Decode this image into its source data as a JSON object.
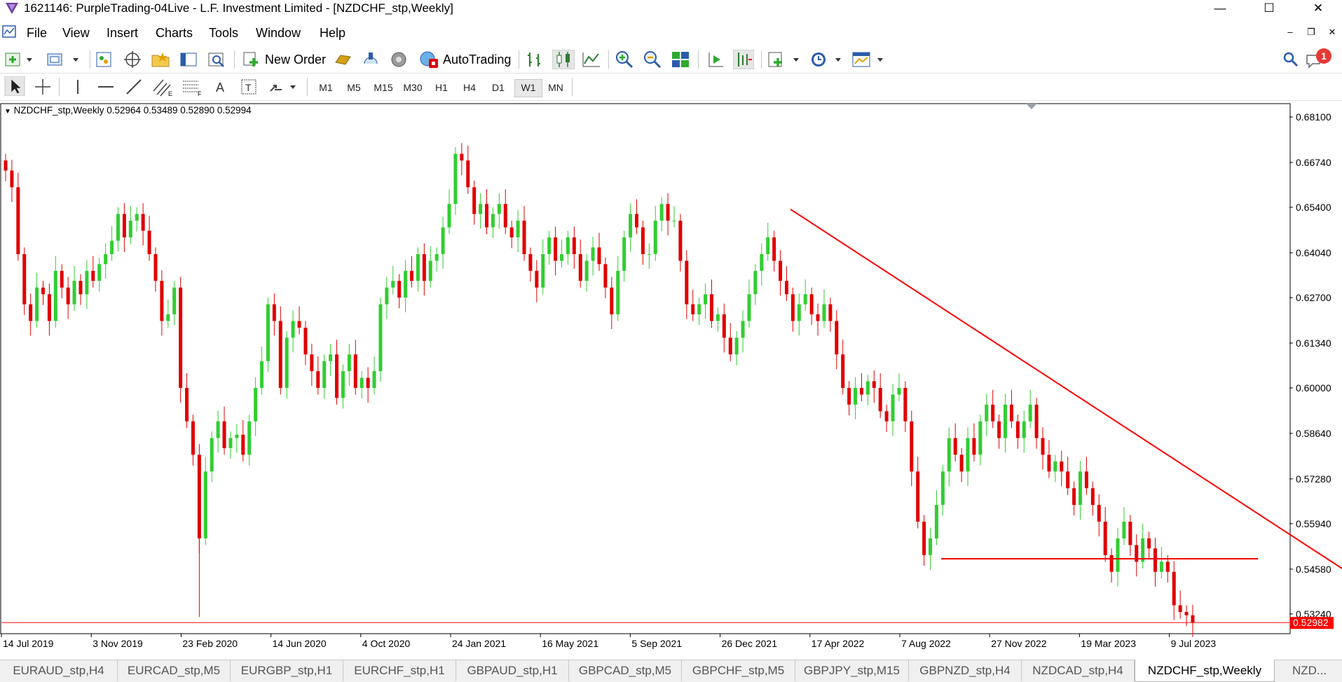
{
  "window": {
    "title": "1621146: PurpleTrading-04Live - L.F. Investment Limited - [NZDCHF_stp,Weekly]",
    "minimize_glyph": "—",
    "maximize_glyph": "☐",
    "close_glyph": "✕"
  },
  "menu": {
    "items": [
      "File",
      "View",
      "Insert",
      "Charts",
      "Tools",
      "Window",
      "Help"
    ],
    "mdi": [
      "–",
      "❐",
      "✕"
    ]
  },
  "toolbar": {
    "new_order": "New Order",
    "autotrading": "AutoTrading",
    "notification_count": "1"
  },
  "timeframes": {
    "items": [
      "M1",
      "M5",
      "M15",
      "M30",
      "H1",
      "H4",
      "D1",
      "W1",
      "MN"
    ],
    "active": "W1"
  },
  "chart": {
    "info": "NZDCHF_stp,Weekly  0.52964 0.53489 0.52890 0.52994",
    "current_price_label": "0.52982",
    "colors": {
      "bull": "#32cd32",
      "bear": "#e00000",
      "trendline": "#ff0000",
      "price_line": "#ff0000",
      "price_label_bg": "#ff0000"
    }
  },
  "chart_data": {
    "type": "candlestick",
    "symbol": "NZDCHF_stp",
    "timeframe": "Weekly",
    "ohlc_last": {
      "open": 0.52964,
      "high": 0.53489,
      "low": 0.5289,
      "close": 0.52994
    },
    "y_ticks": [
      0.681,
      0.6674,
      0.654,
      0.6404,
      0.627,
      0.6134,
      0.6,
      0.5864,
      0.5728,
      0.5594,
      0.5458,
      0.5324
    ],
    "y_tick_labels": [
      "0.68100",
      "0.66740",
      "0.65400",
      "0.64040",
      "0.62700",
      "0.61340",
      "0.60000",
      "0.58640",
      "0.57280",
      "0.55940",
      "0.54580",
      "0.53240"
    ],
    "x_tick_labels": [
      "14 Jul 2019",
      "3 Nov 2019",
      "23 Feb 2020",
      "14 Jun 2020",
      "4 Oct 2020",
      "24 Jan 2021",
      "16 May 2021",
      "5 Sep 2021",
      "26 Dec 2021",
      "17 Apr 2022",
      "7 Aug 2022",
      "27 Nov 2022",
      "19 Mar 2023",
      "9 Jul 2023"
    ],
    "approx_closes": [
      0.665,
      0.66,
      0.64,
      0.625,
      0.62,
      0.63,
      0.628,
      0.62,
      0.635,
      0.63,
      0.625,
      0.632,
      0.628,
      0.635,
      0.632,
      0.637,
      0.64,
      0.644,
      0.652,
      0.645,
      0.65,
      0.652,
      0.647,
      0.64,
      0.632,
      0.62,
      0.622,
      0.63,
      0.6,
      0.59,
      0.58,
      0.555,
      0.575,
      0.585,
      0.59,
      0.582,
      0.585,
      0.586,
      0.58,
      0.59,
      0.6,
      0.608,
      0.625,
      0.62,
      0.6,
      0.615,
      0.62,
      0.618,
      0.61,
      0.605,
      0.6,
      0.608,
      0.61,
      0.597,
      0.605,
      0.61,
      0.6,
      0.603,
      0.6,
      0.605,
      0.625,
      0.63,
      0.632,
      0.627,
      0.635,
      0.632,
      0.64,
      0.632,
      0.638,
      0.64,
      0.648,
      0.655,
      0.67,
      0.668,
      0.66,
      0.652,
      0.655,
      0.648,
      0.652,
      0.655,
      0.648,
      0.645,
      0.65,
      0.64,
      0.635,
      0.63,
      0.64,
      0.645,
      0.638,
      0.64,
      0.645,
      0.64,
      0.632,
      0.638,
      0.642,
      0.637,
      0.63,
      0.622,
      0.635,
      0.645,
      0.652,
      0.648,
      0.64,
      0.64,
      0.65,
      0.655,
      0.65,
      0.65,
      0.638,
      0.625,
      0.622,
      0.625,
      0.628,
      0.62,
      0.622,
      0.615,
      0.61,
      0.615,
      0.62,
      0.628,
      0.635,
      0.64,
      0.645,
      0.638,
      0.632,
      0.628,
      0.62,
      0.625,
      0.628,
      0.622,
      0.62,
      0.625,
      0.62,
      0.61,
      0.6,
      0.595,
      0.6,
      0.598,
      0.602,
      0.6,
      0.593,
      0.59,
      0.598,
      0.6,
      0.59,
      0.575,
      0.56,
      0.55,
      0.555,
      0.565,
      0.575,
      0.585,
      0.58,
      0.575,
      0.585,
      0.58,
      0.59,
      0.595,
      0.59,
      0.585,
      0.595,
      0.59,
      0.585,
      0.59,
      0.595,
      0.585,
      0.58,
      0.575,
      0.578,
      0.575,
      0.57,
      0.565,
      0.575,
      0.57,
      0.565,
      0.56,
      0.55,
      0.545,
      0.555,
      0.56,
      0.553,
      0.548,
      0.555,
      0.552,
      0.545,
      0.548,
      0.545,
      0.535,
      0.533,
      0.532,
      0.5299
    ],
    "trendlines": [
      {
        "kind": "descending-resistance",
        "from": {
          "date": "2022-02-20",
          "price": 0.6534
        },
        "to": {
          "date": "2023-11-05",
          "price": 0.546
        }
      },
      {
        "kind": "horizontal-support",
        "price": 0.5489,
        "from_date": "2022-10-16",
        "to_date": "2023-10-22"
      },
      {
        "kind": "current-price",
        "price": 0.52982
      }
    ]
  },
  "tabs": {
    "items": [
      "EURAUD_stp,H4",
      "EURCAD_stp,M5",
      "EURGBP_stp,H1",
      "EURCHF_stp,H1",
      "GBPAUD_stp,H1",
      "GBPCAD_stp,M5",
      "GBPCHF_stp,M5",
      "GBPJPY_stp,M15",
      "GBPNZD_stp,H4",
      "NZDCAD_stp,H4",
      "NZDCHF_stp,Weekly",
      "NZD..."
    ],
    "active": "NZDCHF_stp,Weekly"
  }
}
